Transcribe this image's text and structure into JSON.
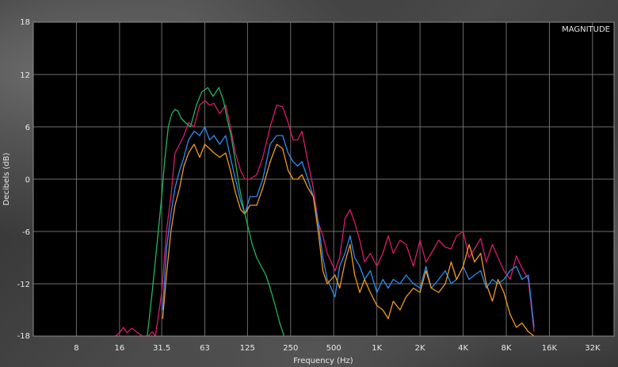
{
  "chart_data": {
    "type": "line",
    "badge": "MAGNITUDE",
    "xlabel": "Frequency (Hz)",
    "ylabel": "Decibels (dB)",
    "xscale": "log2",
    "xlim": [
      4,
      45.2
    ],
    "ylim": [
      -18,
      18
    ],
    "grid": true,
    "x_ticks": [
      {
        "value": 8,
        "label": "8"
      },
      {
        "value": 16,
        "label": "16"
      },
      {
        "value": 31.5,
        "label": "31.5"
      },
      {
        "value": 63,
        "label": "63"
      },
      {
        "value": 125,
        "label": "125"
      },
      {
        "value": 250,
        "label": "250"
      },
      {
        "value": 500,
        "label": "500"
      },
      {
        "value": 1000,
        "label": "1K"
      },
      {
        "value": 2000,
        "label": "2K"
      },
      {
        "value": 4000,
        "label": "4K"
      },
      {
        "value": 8000,
        "label": "8K"
      },
      {
        "value": 16000,
        "label": "16K"
      },
      {
        "value": 32000,
        "label": "32K"
      }
    ],
    "y_ticks": [
      {
        "value": 18,
        "label": "18"
      },
      {
        "value": 12,
        "label": "12"
      },
      {
        "value": 6,
        "label": "6"
      },
      {
        "value": 0,
        "label": "0"
      },
      {
        "value": -6,
        "label": "-6"
      },
      {
        "value": -12,
        "label": "-12"
      },
      {
        "value": -18,
        "label": "-18"
      }
    ],
    "series": [
      {
        "color": "#d81b6a",
        "x": [
          15,
          16,
          17,
          18,
          19.5,
          21,
          23,
          24.5,
          25.5,
          27,
          28.5,
          31.5,
          34,
          36.5,
          39,
          42,
          45,
          48.5,
          53,
          58,
          63,
          68,
          73,
          80,
          88,
          95,
          103,
          112,
          120,
          130,
          145,
          160,
          180,
          200,
          220,
          240,
          260,
          280,
          300,
          330,
          360,
          390,
          420,
          450,
          480,
          510,
          550,
          600,
          650,
          700,
          760,
          820,
          900,
          1000,
          1100,
          1200,
          1300,
          1450,
          1600,
          1800,
          2000,
          2200,
          2400,
          2700,
          3000,
          3300,
          3600,
          4000,
          4400,
          4800,
          5300,
          5800,
          6400,
          7000,
          7700,
          8500,
          9400,
          10300,
          11400,
          12500
        ],
        "y": [
          -18,
          -17.6,
          -17,
          -17.6,
          -17.1,
          -17.5,
          -18.5,
          -19,
          -18.2,
          -17.5,
          -18,
          -13,
          -6,
          -2,
          3,
          4,
          5,
          6.5,
          6,
          8.5,
          9,
          8.5,
          8.7,
          7.5,
          8.5,
          6,
          3,
          1,
          0,
          0,
          0.5,
          2.5,
          6,
          8.5,
          8.3,
          6.5,
          4.5,
          4.5,
          5.5,
          2,
          -1,
          -5,
          -6.5,
          -8.5,
          -9.5,
          -10.5,
          -9,
          -4.5,
          -3.5,
          -5,
          -7,
          -9.5,
          -8.5,
          -10,
          -8.5,
          -6.5,
          -8.5,
          -7,
          -7.5,
          -10,
          -7,
          -9.5,
          -8.5,
          -7,
          -7.8,
          -8,
          -6.5,
          -6,
          -9,
          -8,
          -6.8,
          -9.5,
          -7.5,
          -9,
          -10.5,
          -11.5,
          -8.8,
          -10.2,
          -11.5,
          -17.5
        ]
      },
      {
        "color": "#2d8cf0",
        "x": [
          32,
          34,
          36.5,
          39,
          42,
          45,
          48.5,
          53,
          58,
          63,
          68,
          73,
          80,
          88,
          95,
          103,
          112,
          120,
          130,
          145,
          160,
          180,
          200,
          220,
          240,
          260,
          280,
          300,
          330,
          360,
          390,
          420,
          450,
          480,
          510,
          550,
          600,
          650,
          700,
          760,
          820,
          900,
          1000,
          1100,
          1200,
          1300,
          1450,
          1600,
          1800,
          2000,
          2200,
          2400,
          2700,
          3000,
          3300,
          3600,
          4000,
          4400,
          4800,
          5300,
          5800,
          6400,
          7000,
          7700,
          8500,
          9400,
          10300,
          11400,
          12500
        ],
        "y": [
          -15,
          -8,
          -4,
          -1,
          1,
          2.5,
          4.5,
          5.5,
          5,
          6,
          4.5,
          5,
          4,
          5,
          2.5,
          0,
          -2.5,
          -4,
          -2,
          -2,
          0,
          4,
          5,
          5,
          3,
          2,
          1.5,
          2,
          0,
          -2,
          -5,
          -9,
          -11.5,
          -12.5,
          -13.5,
          -10,
          -8.5,
          -6.5,
          -9,
          -10,
          -11.5,
          -10.5,
          -13,
          -11.5,
          -12.5,
          -11.5,
          -12,
          -11,
          -12,
          -12.5,
          -10,
          -12.5,
          -11.5,
          -10.5,
          -12,
          -11.5,
          -10,
          -11.5,
          -11,
          -10.5,
          -12.5,
          -11.5,
          -12,
          -11.5,
          -10.5,
          -10,
          -11.5,
          -11,
          -17
        ]
      },
      {
        "color": "#f39a1e",
        "x": [
          32,
          34,
          36.5,
          39,
          42,
          45,
          48.5,
          53,
          58,
          63,
          68,
          73,
          80,
          88,
          95,
          103,
          112,
          120,
          130,
          145,
          160,
          180,
          200,
          220,
          240,
          260,
          280,
          300,
          330,
          360,
          390,
          420,
          450,
          480,
          510,
          550,
          600,
          650,
          700,
          760,
          820,
          900,
          1000,
          1100,
          1200,
          1300,
          1450,
          1600,
          1800,
          2000,
          2200,
          2400,
          2700,
          3000,
          3300,
          3600,
          4000,
          4400,
          4800,
          5300,
          5800,
          6400,
          7000,
          7700,
          8500,
          9400,
          10300,
          11400,
          12500
        ],
        "y": [
          -16,
          -11,
          -6,
          -3,
          -1,
          1.5,
          3,
          4,
          2.5,
          4,
          3.5,
          3,
          2.5,
          3,
          1,
          -1.5,
          -3.5,
          -4,
          -3,
          -3,
          -1,
          2,
          4,
          3.5,
          1,
          0,
          0,
          0.5,
          -1,
          -2,
          -6,
          -10.5,
          -12,
          -11.5,
          -11,
          -12.5,
          -9.5,
          -7.5,
          -11,
          -13,
          -11.5,
          -13,
          -14.5,
          -15,
          -16,
          -14,
          -15,
          -13.5,
          -12.5,
          -13,
          -10.5,
          -12.5,
          -13,
          -12,
          -9.5,
          -11.5,
          -10,
          -7.5,
          -9.5,
          -8.5,
          -12,
          -14,
          -11.5,
          -13,
          -15.5,
          -17,
          -16.5,
          -17.5,
          -18
        ]
      },
      {
        "color": "#22b45a",
        "x": [
          25,
          27,
          29,
          31.5,
          33,
          35,
          37,
          39,
          41,
          43,
          46,
          50,
          55,
          60,
          66,
          72,
          79,
          85,
          90,
          96,
          103,
          110,
          118,
          126,
          135,
          145,
          156,
          168,
          180,
          195,
          210,
          225
        ],
        "y": [
          -18.5,
          -13,
          -8,
          -2,
          2,
          6,
          7.5,
          8,
          7.8,
          7,
          6.5,
          6,
          8.5,
          10,
          10.5,
          9.5,
          10.5,
          9,
          7,
          5,
          2,
          -1,
          -3.5,
          -5.5,
          -7.5,
          -9,
          -10,
          -11,
          -12.5,
          -14.5,
          -16.5,
          -18.5
        ]
      }
    ]
  }
}
